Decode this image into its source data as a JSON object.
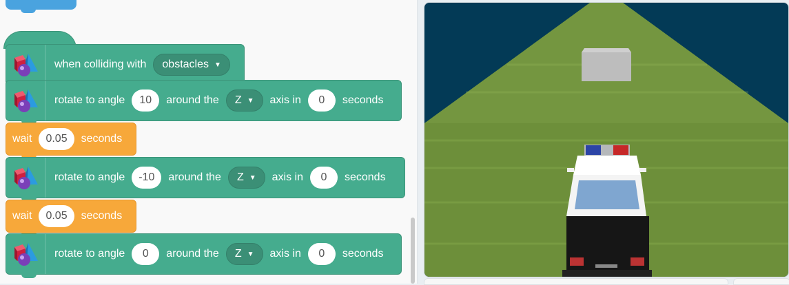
{
  "blocks": {
    "b1": {
      "text": "when colliding with",
      "dropdown": "obstacles"
    },
    "b2": {
      "t1": "rotate to angle",
      "angle": "10",
      "t2": "around the",
      "axis": "Z",
      "t3": "axis in",
      "time": "0",
      "t4": "seconds"
    },
    "b3": {
      "t1": "wait",
      "value": "0.05",
      "t2": "seconds"
    },
    "b4": {
      "t1": "rotate to angle",
      "angle": "-10",
      "t2": "around the",
      "axis": "Z",
      "t3": "axis in",
      "time": "0",
      "t4": "seconds"
    },
    "b5": {
      "t1": "wait",
      "value": "0.05",
      "t2": "seconds"
    },
    "b6": {
      "t1": "rotate to angle",
      "angle": "0",
      "t2": "around the",
      "axis": "Z",
      "t3": "axis in",
      "time": "0",
      "t4": "seconds"
    }
  },
  "icons": {
    "block_icon": "3d-shapes-icon",
    "dropdown_caret": "caret-down-icon"
  },
  "colors": {
    "motion_block": "#45ac8e",
    "control_block": "#f7a83a",
    "sky": "#033a56",
    "grass": "#6d8f3a"
  }
}
